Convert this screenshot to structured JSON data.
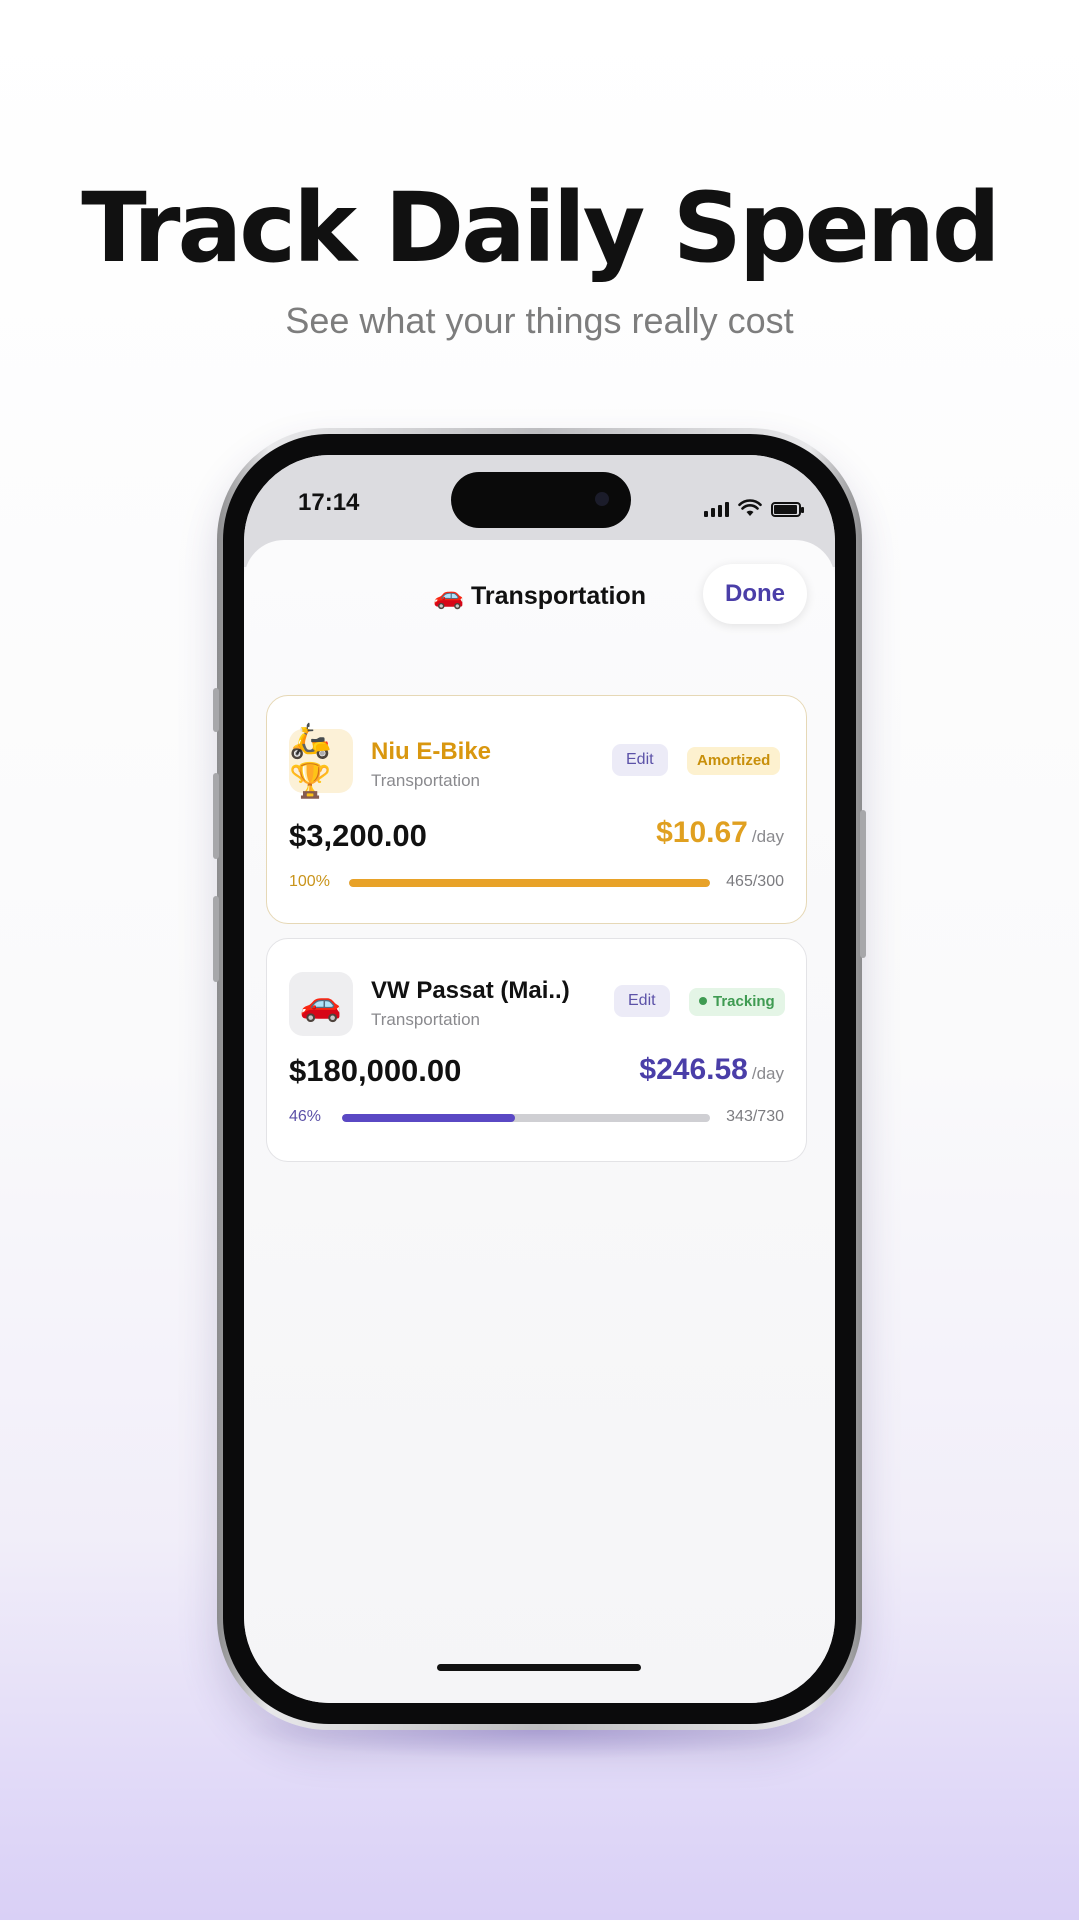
{
  "promo": {
    "headline": "Track Daily Spend",
    "subheadline": "See what your things really cost"
  },
  "status_bar": {
    "time": "17:14",
    "icons": [
      "cellular-signal-icon",
      "wifi-icon",
      "battery-icon"
    ]
  },
  "sheet": {
    "title": "🚗 Transportation",
    "done_label": "Done"
  },
  "items": [
    {
      "icon": "🛵🏆",
      "name": "Niu E-Bike",
      "category": "Transportation",
      "edit_label": "Edit",
      "status_label": "Amortized",
      "price": "$3,200.00",
      "daily_cost": "$10.67",
      "daily_unit": "/day",
      "progress_label": "100%",
      "progress": 1.0,
      "days_label": "465/300"
    },
    {
      "icon": "🚗",
      "name": "VW Passat (Mai..)",
      "category": "Transportation",
      "edit_label": "Edit",
      "status_label": "Tracking",
      "price": "$180,000.00",
      "daily_cost": "$246.58",
      "daily_unit": "/day",
      "progress_label": "46%",
      "progress": 0.47,
      "days_label": "343/730"
    }
  ],
  "colors": {
    "accent": "#4a3ea8",
    "amortized": "#e0a020",
    "tracking": "#3f9b52"
  }
}
